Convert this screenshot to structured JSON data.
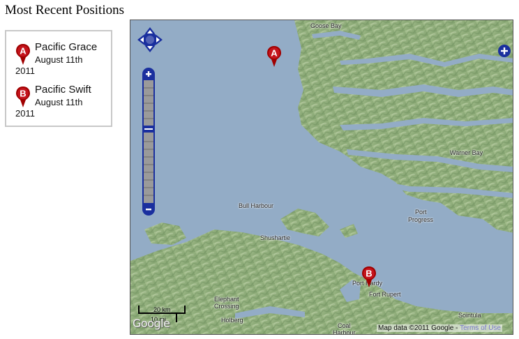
{
  "page": {
    "title": "Most Recent Positions"
  },
  "positions": [
    {
      "marker": "A",
      "name": "Pacific Grace",
      "date": "August 11th",
      "year": "2011"
    },
    {
      "marker": "B",
      "name": "Pacific Swift",
      "date": "August 11th",
      "year": "2011"
    }
  ],
  "map": {
    "places": [
      "Goose Bay",
      "Warner Bay",
      "Bull Harbour",
      "Port",
      "Progress",
      "Shushartie",
      "Port Hardy",
      "Fort Rupert",
      "Elephant",
      "Crossing",
      "Holberg",
      "Coal",
      "Harbour",
      "Sointula"
    ],
    "markers": [
      "A",
      "B"
    ],
    "scale": {
      "top": "20 km",
      "bottom": "10 mi"
    },
    "logo": "Google",
    "attribution": "Map data ©2011 Google - ",
    "terms_link": "Terms of Use"
  },
  "colors": {
    "marker_red": "#a00000",
    "control_blue": "#1a2f9e",
    "water": "#93acc6",
    "land": "#8fae7c"
  },
  "icons": [
    "pan-arrows-icon",
    "zoom-in-icon",
    "zoom-out-icon",
    "map-pin-icon"
  ]
}
